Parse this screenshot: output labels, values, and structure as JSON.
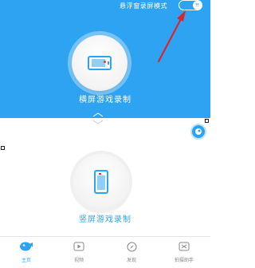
{
  "header": {
    "float_mode_label": "悬浮窗录屏模式",
    "toggle_knob_text": "开"
  },
  "landscape": {
    "label": "横屏游戏录制"
  },
  "portrait": {
    "label": "竖屏游戏录制"
  },
  "nav": {
    "items": [
      {
        "label": "主页",
        "icon": "home-icon"
      },
      {
        "label": "视频",
        "icon": "video-icon"
      },
      {
        "label": "发现",
        "icon": "compass-icon"
      },
      {
        "label": "拍摄助手",
        "icon": "shoot-helper-icon"
      }
    ]
  },
  "colors": {
    "accent": "#2ea3f2",
    "annotation_arrow": "#d8262b"
  }
}
